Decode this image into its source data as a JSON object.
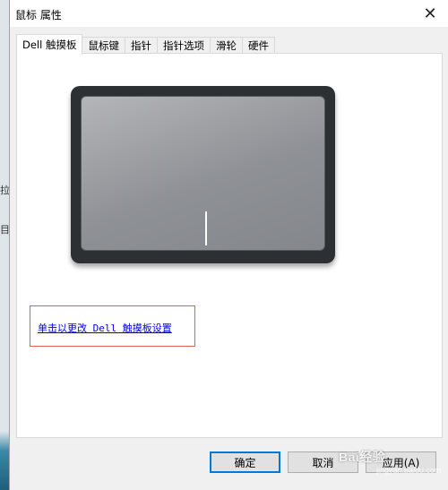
{
  "window": {
    "title": "鼠标 属性",
    "close_glyph": "✕"
  },
  "background": {
    "mark_top": "",
    "mark_1": "拉",
    "mark_2": "目"
  },
  "tabs": [
    {
      "label": "Dell 触摸板",
      "active": true
    },
    {
      "label": "鼠标键",
      "active": false
    },
    {
      "label": "指针",
      "active": false
    },
    {
      "label": "指针选项",
      "active": false
    },
    {
      "label": "滑轮",
      "active": false
    },
    {
      "label": "硬件",
      "active": false
    }
  ],
  "panel": {
    "settings_link": "单击以更改 Dell 触摸板设置"
  },
  "buttons": {
    "ok": "确定",
    "cancel": "取消",
    "apply": "应用(A)"
  },
  "watermark": {
    "brand": "Bai经验",
    "sub": "jingyan.baidu.com"
  },
  "colors": {
    "link": "#0000ee",
    "highlight_box": "#e06060",
    "primary_border": "#0078d7"
  }
}
